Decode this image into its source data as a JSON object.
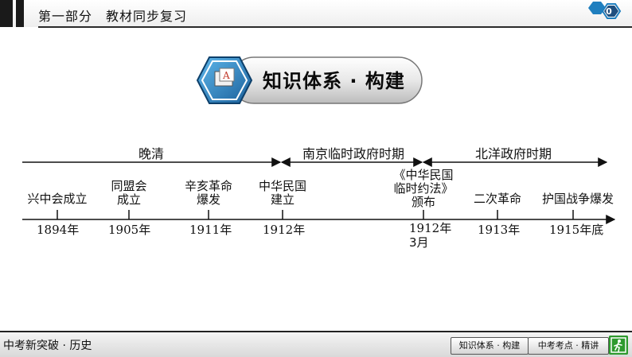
{
  "header": {
    "title": "第一部分　教材同步复习",
    "page_number": "0"
  },
  "banner": {
    "title": "知识体系 · 构建"
  },
  "timeline": {
    "periods": [
      {
        "label": "晚清"
      },
      {
        "label": "南京临时政府时期"
      },
      {
        "label": "北洋政府时期"
      }
    ],
    "events": [
      {
        "lines": [
          "兴中会成立"
        ],
        "year": "1894",
        "unit": "年",
        "extra": ""
      },
      {
        "lines": [
          "同盟会",
          "成立"
        ],
        "year": "1905",
        "unit": "年",
        "extra": ""
      },
      {
        "lines": [
          "辛亥革命",
          "爆发"
        ],
        "year": "1911",
        "unit": "年",
        "extra": ""
      },
      {
        "lines": [
          "中华民国",
          "建立"
        ],
        "year": "1912",
        "unit": "年",
        "extra": ""
      },
      {
        "lines": [
          "《中华民国",
          "临时约法》",
          "颁布"
        ],
        "year": "1912",
        "unit": "年",
        "extra": "3月"
      },
      {
        "lines": [
          "二次革命"
        ],
        "year": "1913",
        "unit": "年",
        "extra": ""
      },
      {
        "lines": [
          "护国战争爆发"
        ],
        "year": "1915",
        "unit": "年底",
        "extra": ""
      }
    ]
  },
  "footer": {
    "brand": "中考新突破 · 历史",
    "btn_knowledge": "知识体系 · 构建",
    "btn_exam": "中考考点 · 精讲"
  },
  "colors": {
    "accent_blue": "#1f7fbf",
    "exit_green": "#2e9a2e",
    "line": "#111111"
  }
}
